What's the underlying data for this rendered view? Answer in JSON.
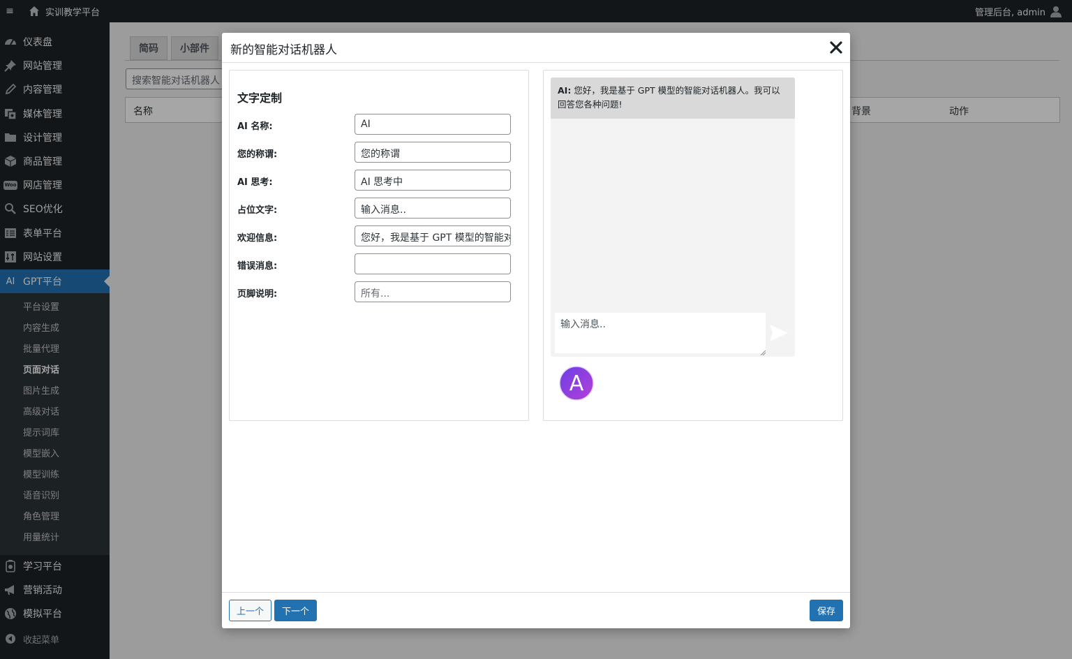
{
  "adminbar": {
    "menu_toggle": "≡",
    "site_name": "实训教学平台",
    "account": "管理后台, admin"
  },
  "sidebar": {
    "items": [
      {
        "label": "仪表盘",
        "icon": "dashboard-icon"
      },
      {
        "label": "网站管理",
        "icon": "pin-icon"
      },
      {
        "label": "内容管理",
        "icon": "pencil-icon"
      },
      {
        "label": "媒体管理",
        "icon": "media-icon"
      },
      {
        "label": "设计管理",
        "icon": "folder-icon"
      },
      {
        "label": "商品管理",
        "icon": "box-icon"
      },
      {
        "label": "网店管理",
        "icon": "woo-icon"
      },
      {
        "label": "SEO优化",
        "icon": "search-icon"
      },
      {
        "label": "表单平台",
        "icon": "form-icon"
      },
      {
        "label": "网站设置",
        "icon": "settings-icon"
      },
      {
        "label": "GPT平台",
        "icon": "ai-icon"
      }
    ],
    "ai_icon_text": "AI",
    "woo_icon_text": "Woo",
    "submenu": [
      "平台设置",
      "内容生成",
      "批量代理",
      "页面对话",
      "图片生成",
      "高级对话",
      "提示词库",
      "模型嵌入",
      "模型训练",
      "语音识别",
      "角色管理",
      "用量统计"
    ],
    "bottom_items": [
      {
        "label": "学习平台",
        "icon": "learn-icon"
      },
      {
        "label": "营销活动",
        "icon": "megaphone-icon"
      },
      {
        "label": "模拟平台",
        "icon": "globe-icon"
      }
    ],
    "collapse": "收起菜单"
  },
  "background": {
    "tabs": [
      "简码",
      "小部件"
    ],
    "search_placeholder": "搜索智能对话机器人",
    "table_headers": [
      "名称",
      "背景",
      "动作"
    ]
  },
  "modal": {
    "title": "新的智能对话机器人",
    "close": "✕",
    "section_title": "文字定制",
    "fields": [
      {
        "label": "AI 名称:",
        "value": "AI",
        "placeholder": ""
      },
      {
        "label": "您的称谓:",
        "value": "您的称谓",
        "placeholder": ""
      },
      {
        "label": "AI 思考:",
        "value": "AI 思考中",
        "placeholder": ""
      },
      {
        "label": "占位文字:",
        "value": "输入消息..",
        "placeholder": ""
      },
      {
        "label": "欢迎信息:",
        "value": "您好，我是基于 GPT 模型的智能对话机器人。我可以回答您各种问题!",
        "placeholder": ""
      },
      {
        "label": "错误消息:",
        "value": "",
        "placeholder": ""
      },
      {
        "label": "页脚说明:",
        "value": "",
        "placeholder": "所有..."
      }
    ],
    "chat": {
      "ai_name": "AI:",
      "welcome": "您好，我是基于 GPT 模型的智能对话机器人。我可以回答您各种问题!",
      "input_placeholder": "输入消息..",
      "avatar_letter": "A"
    },
    "footer": {
      "prev": "上一个",
      "next": "下一个",
      "save": "保存"
    }
  },
  "colors": {
    "admin_dark": "#1d2327",
    "accent": "#2271b1",
    "avatar_gradient_start": "#7b3fe4",
    "avatar_gradient_end": "#b73fd8"
  }
}
